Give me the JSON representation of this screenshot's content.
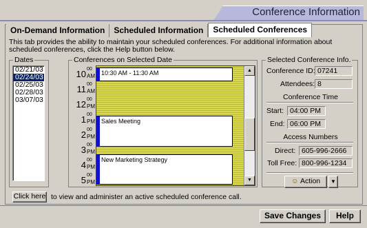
{
  "header": {
    "title": "Conference Information"
  },
  "tabs": [
    {
      "label": "On-Demand Information"
    },
    {
      "label": "Scheduled Information"
    },
    {
      "label": "Scheduled Conferences"
    }
  ],
  "description": "This tab provides the ability to maintain your scheduled conferences.  For additional information about scheduled conferences, click the Help button below.",
  "dates": {
    "label": "Dates",
    "items": [
      "02/21/03",
      "02/24/03",
      "02/25/03",
      "02/28/03",
      "03/07/03"
    ],
    "selected": "02/24/03"
  },
  "schedule": {
    "label": "Conferences on Selected Date",
    "times": [
      {
        "hour": "10",
        "min": "00",
        "ampm": "AM"
      },
      {
        "hour": "11",
        "min": "00",
        "ampm": "AM"
      },
      {
        "hour": "12",
        "min": "00",
        "ampm": "PM"
      },
      {
        "hour": "1",
        "min": "00",
        "ampm": "PM"
      },
      {
        "hour": "2",
        "min": "00",
        "ampm": "PM"
      },
      {
        "hour": "3",
        "min": "00",
        "ampm": "PM"
      },
      {
        "hour": "4",
        "min": "00",
        "ampm": "PM"
      },
      {
        "hour": "5",
        "min": "00",
        "ampm": "PM"
      }
    ],
    "events": [
      {
        "title": "10:30 AM - 11:30 AM"
      },
      {
        "title": "Sales Meeting"
      },
      {
        "title": "New Marketing Strategy"
      }
    ]
  },
  "info": {
    "label": "Selected Conference Info.",
    "conference_id_label": "Conference ID:",
    "conference_id": "07241",
    "attendees_label": "Attendees:",
    "attendees": "8",
    "time_title": "Conference Time",
    "start_label": "Start:",
    "start": "04:00 PM",
    "end_label": "End:",
    "end": "06:00 PM",
    "access_title": "Access Numbers",
    "direct_label": "Direct:",
    "direct": "605-996-2666",
    "tollfree_label": "Toll Free:",
    "tollfree": "800-996-1234",
    "action_label": "Action"
  },
  "bottom": {
    "click_here": "Click here",
    "click_here_text": "to view and administer an active scheduled conference call."
  },
  "footer": {
    "save_label": "Save Changes",
    "help_label": "Help"
  }
}
